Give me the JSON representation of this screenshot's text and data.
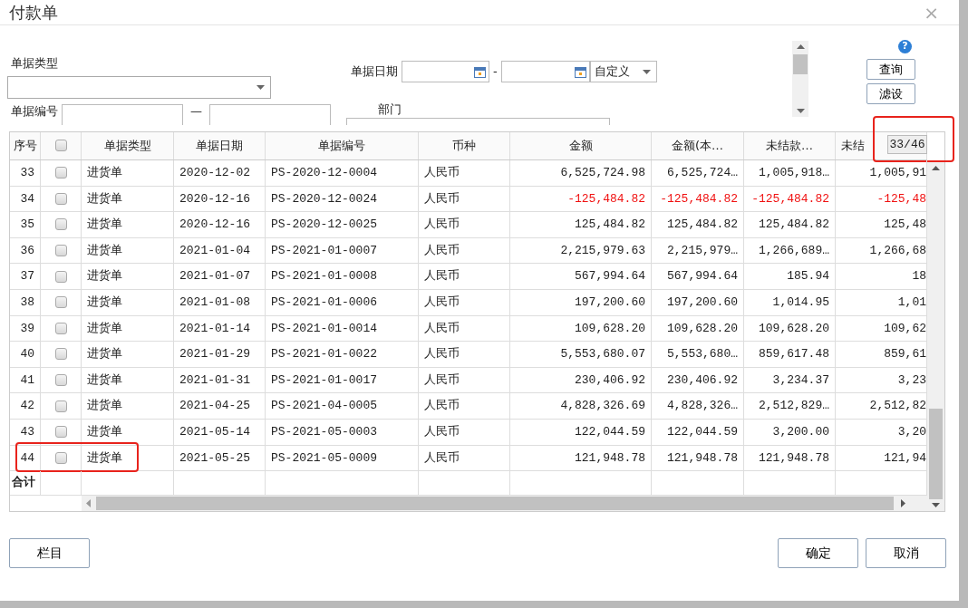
{
  "dialog": {
    "title": "付款单",
    "close": "×"
  },
  "filters": {
    "doc_type": {
      "label": "单据类型"
    },
    "doc_date": {
      "label": "单据日期",
      "separator": "-",
      "range": "自定义"
    },
    "doc_no": {
      "label": "单据编号",
      "separator": "—"
    },
    "department": {
      "label": "部门"
    }
  },
  "help": "?",
  "actions": [
    "查询",
    "滤设"
  ],
  "table": {
    "columns": [
      "序号",
      "单据类型",
      "单据日期",
      "单据编号",
      "币种",
      "金额",
      "金额(本…",
      "未结款…",
      "未结"
    ],
    "select_all_checked": false,
    "pager": {
      "text": "33/46",
      "highlighted": true
    },
    "rows": [
      {
        "no": "33",
        "checked": false,
        "type": "进货单",
        "date": "2020-12-02",
        "number": "PS-2020-12-0004",
        "currency": "人民币",
        "amount": "6,525,724.98",
        "amount_local": "6,525,724…",
        "unpaid": "1,005,918…",
        "unpaid_2": "1,005,91",
        "negative": false,
        "highlighted": false
      },
      {
        "no": "34",
        "checked": false,
        "type": "进货单",
        "date": "2020-12-16",
        "number": "PS-2020-12-0024",
        "currency": "人民币",
        "amount": "-125,484.82",
        "amount_local": "-125,484.82",
        "unpaid": "-125,484.82",
        "unpaid_2": "-125,48",
        "negative": true,
        "highlighted": false
      },
      {
        "no": "35",
        "checked": false,
        "type": "进货单",
        "date": "2020-12-16",
        "number": "PS-2020-12-0025",
        "currency": "人民币",
        "amount": "125,484.82",
        "amount_local": "125,484.82",
        "unpaid": "125,484.82",
        "unpaid_2": "125,48",
        "negative": false,
        "highlighted": false
      },
      {
        "no": "36",
        "checked": false,
        "type": "进货单",
        "date": "2021-01-04",
        "number": "PS-2021-01-0007",
        "currency": "人民币",
        "amount": "2,215,979.63",
        "amount_local": "2,215,979…",
        "unpaid": "1,266,689…",
        "unpaid_2": "1,266,68",
        "negative": false,
        "highlighted": false
      },
      {
        "no": "37",
        "checked": false,
        "type": "进货单",
        "date": "2021-01-07",
        "number": "PS-2021-01-0008",
        "currency": "人民币",
        "amount": "567,994.64",
        "amount_local": "567,994.64",
        "unpaid": "185.94",
        "unpaid_2": "18",
        "negative": false,
        "highlighted": false
      },
      {
        "no": "38",
        "checked": false,
        "type": "进货单",
        "date": "2021-01-08",
        "number": "PS-2021-01-0006",
        "currency": "人民币",
        "amount": "197,200.60",
        "amount_local": "197,200.60",
        "unpaid": "1,014.95",
        "unpaid_2": "1,01",
        "negative": false,
        "highlighted": false
      },
      {
        "no": "39",
        "checked": false,
        "type": "进货单",
        "date": "2021-01-14",
        "number": "PS-2021-01-0014",
        "currency": "人民币",
        "amount": "109,628.20",
        "amount_local": "109,628.20",
        "unpaid": "109,628.20",
        "unpaid_2": "109,62",
        "negative": false,
        "highlighted": false
      },
      {
        "no": "40",
        "checked": false,
        "type": "进货单",
        "date": "2021-01-29",
        "number": "PS-2021-01-0022",
        "currency": "人民币",
        "amount": "5,553,680.07",
        "amount_local": "5,553,680…",
        "unpaid": "859,617.48",
        "unpaid_2": "859,61",
        "negative": false,
        "highlighted": false
      },
      {
        "no": "41",
        "checked": false,
        "type": "进货单",
        "date": "2021-01-31",
        "number": "PS-2021-01-0017",
        "currency": "人民币",
        "amount": "230,406.92",
        "amount_local": "230,406.92",
        "unpaid": "3,234.37",
        "unpaid_2": "3,23",
        "negative": false,
        "highlighted": false
      },
      {
        "no": "42",
        "checked": false,
        "type": "进货单",
        "date": "2021-04-25",
        "number": "PS-2021-04-0005",
        "currency": "人民币",
        "amount": "4,828,326.69",
        "amount_local": "4,828,326…",
        "unpaid": "2,512,829…",
        "unpaid_2": "2,512,82",
        "negative": false,
        "highlighted": false
      },
      {
        "no": "43",
        "checked": false,
        "type": "进货单",
        "date": "2021-05-14",
        "number": "PS-2021-05-0003",
        "currency": "人民币",
        "amount": "122,044.59",
        "amount_local": "122,044.59",
        "unpaid": "3,200.00",
        "unpaid_2": "3,20",
        "negative": false,
        "highlighted": false
      },
      {
        "no": "44",
        "checked": false,
        "type": "进货单",
        "date": "2021-05-25",
        "number": "PS-2021-05-0009",
        "currency": "人民币",
        "amount": "121,948.78",
        "amount_local": "121,948.78",
        "unpaid": "121,948.78",
        "unpaid_2": "121,94",
        "negative": false,
        "highlighted": true
      }
    ],
    "total_label": "合计"
  },
  "footer": {
    "left": "栏目",
    "right": [
      "确定",
      "取消"
    ]
  }
}
